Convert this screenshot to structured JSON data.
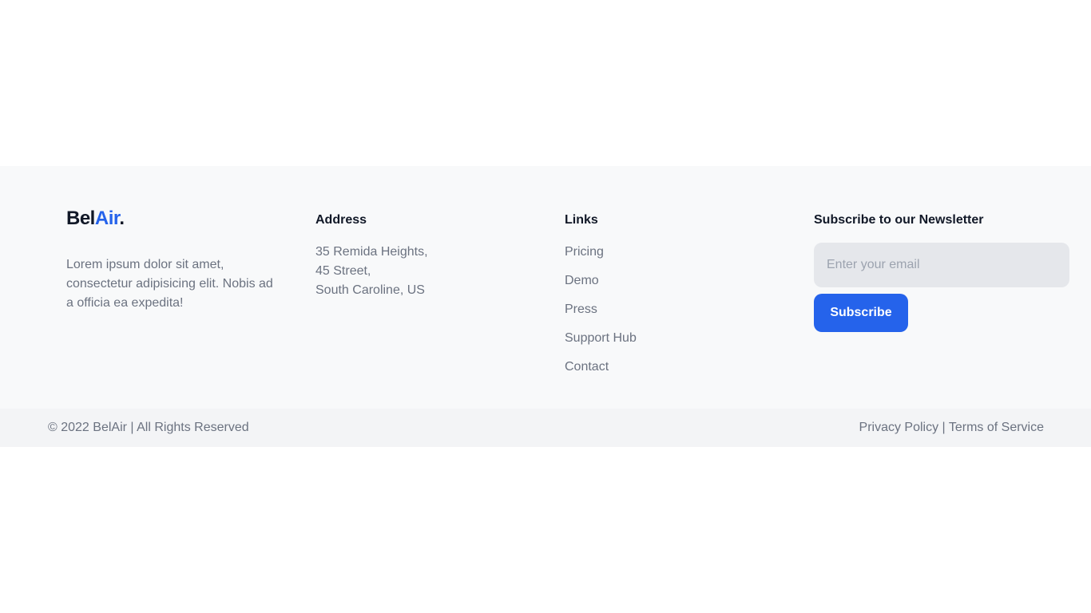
{
  "brand": {
    "name_part1": "Bel",
    "name_part2": "Air",
    "name_dot": ".",
    "description": "Lorem ipsum dolor sit amet, consectetur adipisicing elit. Nobis ad a officia ea expedita!"
  },
  "address": {
    "heading": "Address",
    "line1": "35 Remida Heights,",
    "line2": "45 Street,",
    "line3": "South Caroline, US"
  },
  "links": {
    "heading": "Links",
    "items": [
      "Pricing",
      "Demo",
      "Press",
      "Support Hub",
      "Contact"
    ]
  },
  "newsletter": {
    "heading": "Subscribe to our Newsletter",
    "placeholder": "Enter your email",
    "value": "",
    "button_label": "Subscribe"
  },
  "bottom_bar": {
    "copyright": "© 2022 BelAir | All Rights Reserved",
    "privacy_label": "Privacy Policy",
    "separator": " | ",
    "terms_label": "Terms of Service"
  },
  "colors": {
    "accent": "#2563eb",
    "footer_bg": "#f8f9fa",
    "bottom_bar_bg": "#f3f4f6",
    "muted_text": "#6b7280"
  }
}
